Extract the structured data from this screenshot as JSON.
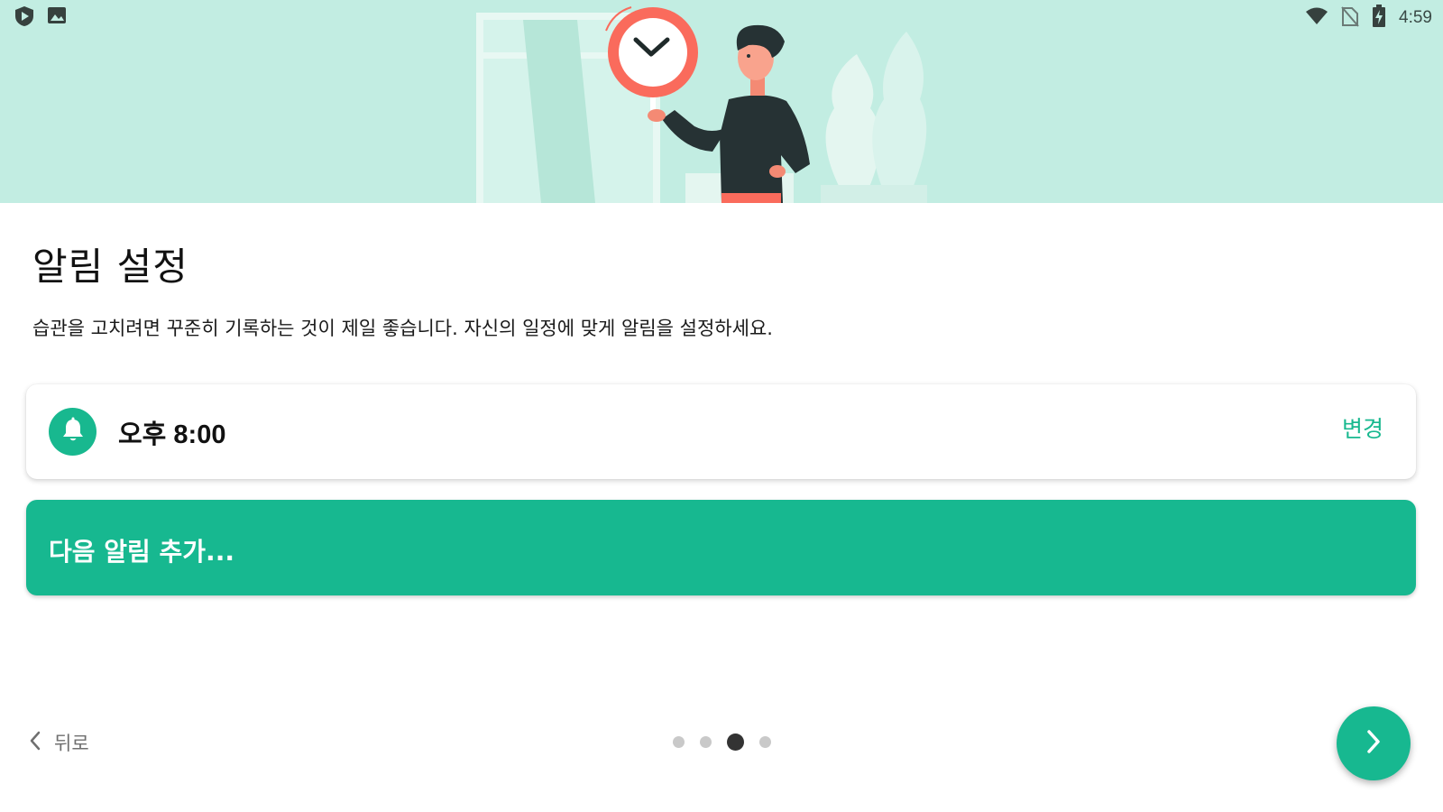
{
  "status_bar": {
    "time": "4:59",
    "left_icons": [
      "shield-play-icon",
      "image-icon"
    ],
    "right_icons": [
      "wifi-icon",
      "no-sim-icon",
      "battery-charging-icon"
    ]
  },
  "hero": {
    "illustration": "person-holding-clock-illustration"
  },
  "page": {
    "title": "알림 설정",
    "description": "습관을 고치려면 꾸준히 기록하는 것이 제일 좋습니다. 자신의 일정에 맞게 알림을 설정하세요."
  },
  "reminder": {
    "icon": "bell-icon",
    "time": "오후 8:00",
    "change_label": "변경"
  },
  "add_reminder": {
    "label": "다음 알림 추가..."
  },
  "footer": {
    "back_label": "뒤로",
    "page_count": 4,
    "current_page": 3,
    "next_icon": "chevron-right-icon"
  },
  "colors": {
    "accent": "#17b890",
    "hero_background": "#c2ede2",
    "clock_ring": "#fa6b5c",
    "title_text": "#111111"
  }
}
